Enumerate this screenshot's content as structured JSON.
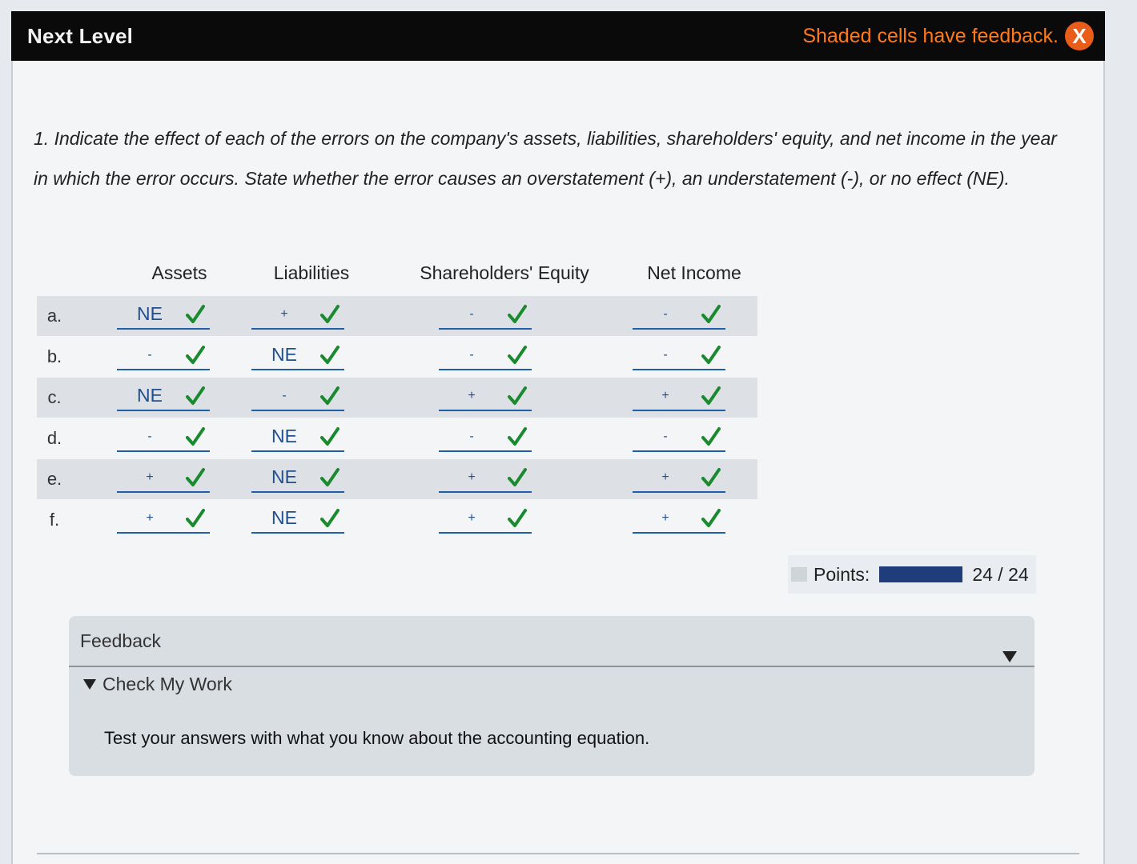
{
  "window": {
    "title": "Next Level",
    "feedback_note": "Shaded cells have feedback.",
    "close_label": "X"
  },
  "question": {
    "text": "1. Indicate the effect of each of the errors on the company's assets, liabilities, shareholders' equity, and net income in the year in which the error occurs. State whether the error causes an overstatement (+), an understatement (-), or no effect (NE)."
  },
  "table": {
    "headers": [
      "Assets",
      "Liabilities",
      "Shareholders' Equity",
      "Net Income"
    ],
    "rows": [
      {
        "label": "a.",
        "cells": [
          "NE",
          "+",
          "-",
          "-"
        ]
      },
      {
        "label": "b.",
        "cells": [
          "-",
          "NE",
          "-",
          "-"
        ]
      },
      {
        "label": "c.",
        "cells": [
          "NE",
          "-",
          "+",
          "+"
        ]
      },
      {
        "label": "d.",
        "cells": [
          "-",
          "NE",
          "-",
          "-"
        ]
      },
      {
        "label": "e.",
        "cells": [
          "+",
          "NE",
          "+",
          "+"
        ]
      },
      {
        "label": "f.",
        "cells": [
          "+",
          "NE",
          "+",
          "+"
        ]
      }
    ],
    "status_icon": "check-icon",
    "status_color": "#1a8a2e"
  },
  "points": {
    "label": "Points:",
    "score": "24 / 24",
    "fraction": 1.0
  },
  "feedback": {
    "header": "Feedback",
    "toggle_label": "Check My Work",
    "text": "Test your answers with what you know about the accounting equation."
  },
  "colors": {
    "titlebar": "#0a0a0a",
    "feedback_note": "#ff7a1a",
    "close_button": "#ea5c1a",
    "answer_text": "#1f4f8f",
    "answer_underline": "#1f5fa8",
    "points_bar": "#1e3d7a"
  }
}
